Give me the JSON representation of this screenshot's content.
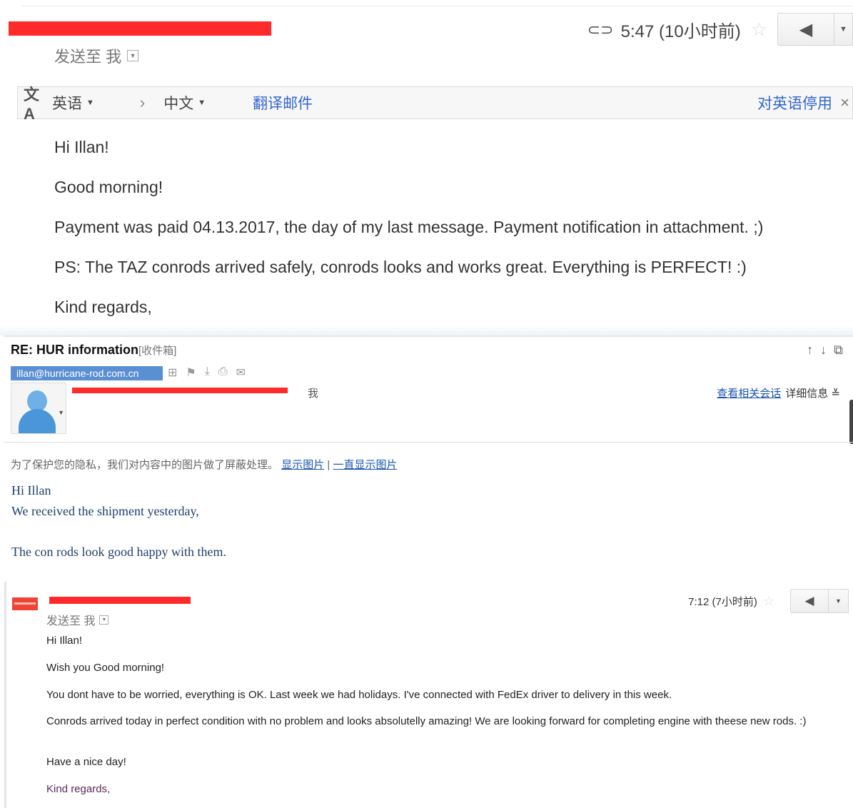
{
  "panel1": {
    "time": "5:47 (10小时前)",
    "send_to": "发送至 我",
    "translate_bar": {
      "source_lang": "英语",
      "target_lang": "中文",
      "translate_link": "翻译邮件",
      "stop_link": "对英语停用",
      "close": "×"
    },
    "body": [
      "Hi Illan!",
      "Good morning!",
      "Payment was paid 04.13.2017, the day of my last message. Payment notification in attachment. ;)",
      "PS: The TAZ conrods arrived safely, conrods looks and works great. Everything is PERFECT! :)",
      "Kind regards,"
    ]
  },
  "panel2": {
    "subject": "RE: HUR information",
    "folder": "[收件箱]",
    "email_tag": "illan@hurricane-rod.com.cn",
    "sender_suffix": "我",
    "related_link": "查看相关会话",
    "details": "详细信息",
    "privacy_text": "为了保护您的隐私，我们对内容中的图片做了屏蔽处理。",
    "show_images": "显示图片",
    "separator": "|",
    "always_show": "一直显示图片",
    "body": [
      "Hi Illan",
      "We received the shipment yesterday,",
      "The con rods look good happy with them."
    ]
  },
  "panel3": {
    "time": "7:12 (7小时前)",
    "send_to": "发送至 我",
    "body": [
      "Hi Illan!",
      "Wish you Good morning!",
      "You dont have to be worried, everything is OK. Last week we had holidays. I've connected with FedEx driver to delivery in this week.",
      "Conrods arrived today in perfect condition with no problem and looks absolutelly amazing! We are looking forward for completing engine with theese new rods. :)",
      "Have a nice day!",
      "Kind regards,"
    ]
  },
  "icons": {
    "attachment": "attachment-icon",
    "star": "star-icon",
    "reply": "reply-icon",
    "translate": "translate-icon",
    "avatar": "default-avatar-icon"
  },
  "colors": {
    "redaction": "#ff2b2b",
    "link": "#3366cc",
    "email_tag_bg": "#5b8fd4"
  }
}
